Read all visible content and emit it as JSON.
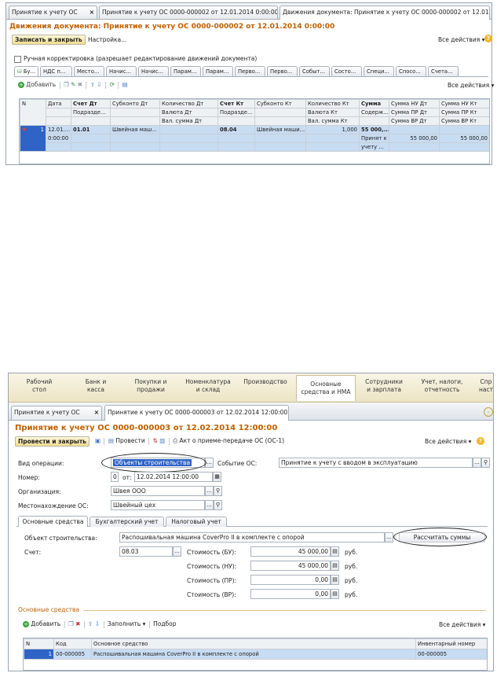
{
  "top": {
    "tabs": [
      {
        "label": "Принятие к учету ОС"
      },
      {
        "label": "Принятие к учету ОС 0000-000002 от 12.01.2014 0:00:00"
      },
      {
        "label": "Движения документа: Принятие к учету ОС 0000-000002 от 12.01.201..."
      }
    ],
    "title": "Движения документа: Принятие к учету ОС 0000-000002 от 12.01.2014 0:00:00",
    "save_close": "Записать и закрыть",
    "settings": "Настройка...",
    "all_actions": "Все действия",
    "manual_edit": "Ручная корректировка (разрешает редактирование движений документа)",
    "reg_tabs": [
      "Бу...",
      "НДС п...",
      "Место...",
      "Начис...",
      "Начис...",
      "Парам...",
      "Парам...",
      "Перво...",
      "Перво...",
      "Событ...",
      "Состо...",
      "Специ...",
      "Спосо...",
      "Счета..."
    ],
    "add": "Добавить",
    "grid_all_actions": "Все действия",
    "headers": {
      "row1": [
        "N",
        "Дата",
        "Счет Дт",
        "Субконто Дт",
        "Количество Дт",
        "Счет Кт",
        "Субконто Кт",
        "Количество Кт",
        "Сумма",
        "Сумма НУ Дт",
        "Сумма НУ Кт"
      ],
      "row2": [
        "Подразде...",
        "Валюта Дт",
        "Подразде...",
        "Валюта Кт",
        "Содерж...",
        "Сумма ПР Дт",
        "Сумма ПР Кт"
      ],
      "row3": [
        "Вал. сумма Дт",
        "Вал. сумма Кт",
        "Сумма ВР Дт",
        "Сумма ВР Кт"
      ]
    },
    "row": {
      "n": "1",
      "date1": "12.01....",
      "date2": "0:00:00",
      "acc_dt": "01.01",
      "sub_dt": "Швейная маш...",
      "acc_kt": "08.04",
      "sub_kt": "Швейная маши...",
      "qty_kt": "1,000",
      "sum": "55 000,...",
      "content1": "Принят к",
      "content2": "учету ...",
      "nu_dt": "55 000,00",
      "nu_kt": "55 000,00"
    }
  },
  "bottom": {
    "sections": [
      {
        "line1": "Рабочий",
        "line2": "стол"
      },
      {
        "line1": "Банк и",
        "line2": "касса"
      },
      {
        "line1": "Покупки и",
        "line2": "продажи"
      },
      {
        "line1": "Номенклатура",
        "line2": "и склад"
      },
      {
        "line1": "Производство",
        "line2": ""
      },
      {
        "line1": "Основные",
        "line2": "средства и НМА"
      },
      {
        "line1": "Сотрудники",
        "line2": "и зарплата"
      },
      {
        "line1": "Учет, налоги,",
        "line2": "отчетность"
      },
      {
        "line1": "Спр",
        "line2": "наст"
      }
    ],
    "tabs": [
      {
        "label": "Принятие к учету ОС"
      },
      {
        "label": "Принятие к учету ОС 0000-000003 от 12.02.2014 12:00:00"
      }
    ],
    "title": "Принятие к учету ОС 0000-000003 от 12.02.2014 12:00:00",
    "post_close": "Провести и закрыть",
    "post": "Провести",
    "act": "Акт о приеме-передаче ОС (ОС-1)",
    "all_actions": "Все действия",
    "labels": {
      "op_type": "Вид операции:",
      "event": "Событие ОС:",
      "number": "Номер:",
      "from": "от:",
      "org": "Организация:",
      "location": "Местонахождение ОС:"
    },
    "values": {
      "op_type": "Объекты строительства",
      "event": "Принятие к учету с вводом в эксплуатацию",
      "number": "0",
      "date": "12.02.2014 12:00:00",
      "org": "Швея ООО",
      "location": "Швейный цех"
    },
    "inner_tabs": [
      "Основные средства",
      "Бухгалтерский учет",
      "Налоговый учет"
    ],
    "construction_label": "Объект строительства:",
    "construction_value": "Распошивальная машина CoverPro II в комплекте с опорой",
    "calc_button": "Рассчитать суммы",
    "account_label": "Счет:",
    "account_value": "08.03",
    "costs": [
      {
        "label": "Стоимость (БУ):",
        "value": "45 000,00",
        "unit": "руб."
      },
      {
        "label": "Стоимость (НУ):",
        "value": "45 000,00",
        "unit": "руб."
      },
      {
        "label": "Стоимость (ПР):",
        "value": "0,00",
        "unit": "руб."
      },
      {
        "label": "Стоимость (ВР):",
        "value": "0,00",
        "unit": "руб."
      }
    ],
    "os_group": "Основные средства",
    "add": "Добавить",
    "fill": "Заполнить",
    "selection": "Подбор",
    "grid_all_actions": "Все действия",
    "grid_headers": [
      "N",
      "Код",
      "Основное средство",
      "Инвентарный номер"
    ],
    "grid_row": {
      "n": "1",
      "code": "00-000005",
      "name": "Распошивальная машина CoverPro II в комплекте с опорой",
      "inv": "00-000005"
    }
  },
  "colors": {
    "accent_orange": "#c06000",
    "selection_blue": "#c8dcf2",
    "highlight": "#2f63c6",
    "button_yellow": "#f0dc90"
  }
}
